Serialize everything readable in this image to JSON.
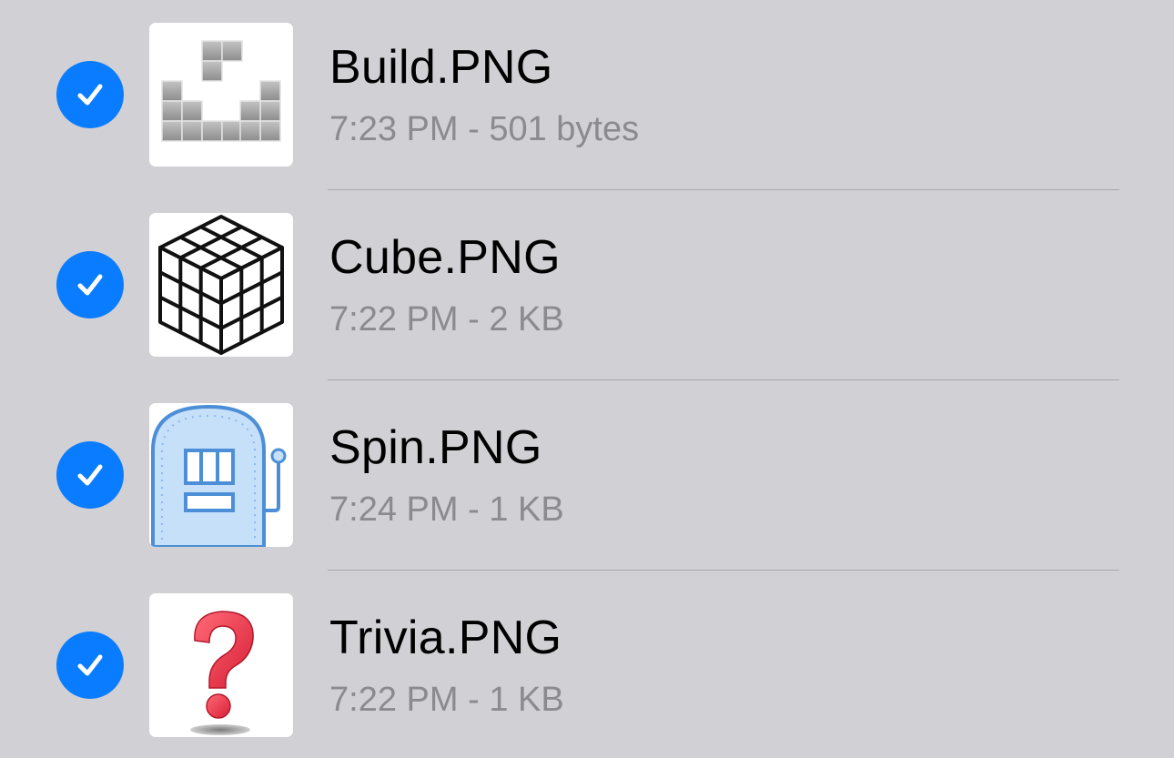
{
  "files": [
    {
      "name": "Build.PNG",
      "time": "7:23 PM",
      "separator": " - ",
      "size": "501 bytes",
      "selected": true,
      "thumbnail_icon": "build-blocks-icon"
    },
    {
      "name": "Cube.PNG",
      "time": "7:22 PM",
      "separator": " - ",
      "size": "2 KB",
      "selected": true,
      "thumbnail_icon": "cube-icon"
    },
    {
      "name": "Spin.PNG",
      "time": "7:24 PM",
      "separator": " - ",
      "size": "1 KB",
      "selected": true,
      "thumbnail_icon": "slot-machine-icon"
    },
    {
      "name": "Trivia.PNG",
      "time": "7:22 PM",
      "separator": " - ",
      "size": "1 KB",
      "selected": true,
      "thumbnail_icon": "question-mark-icon"
    }
  ],
  "colors": {
    "background": "#d1d0d5",
    "checkmark_accent": "#0a7cff",
    "meta_text": "#8a8a8f",
    "separator": "#a9a8ad"
  }
}
